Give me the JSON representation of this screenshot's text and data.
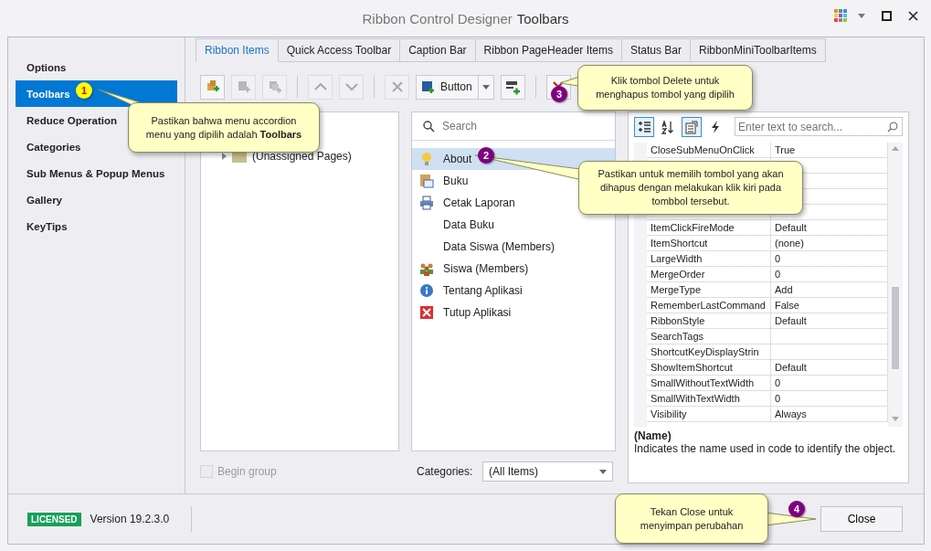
{
  "window": {
    "title": "Ribbon Control Designer",
    "subtitle": "Toolbars"
  },
  "sidebar": {
    "items": [
      {
        "label": "Options",
        "selected": false
      },
      {
        "label": "Toolbars",
        "selected": true
      },
      {
        "label": "Reduce Operation",
        "selected": false
      },
      {
        "label": "Categories",
        "selected": false
      },
      {
        "label": "Sub Menus & Popup Menus",
        "selected": false
      },
      {
        "label": "Gallery",
        "selected": false
      },
      {
        "label": "KeyTips",
        "selected": false
      }
    ]
  },
  "tabs": [
    {
      "label": "Ribbon Items",
      "selected": true
    },
    {
      "label": "Quick Access Toolbar",
      "selected": false
    },
    {
      "label": "Caption Bar",
      "selected": false
    },
    {
      "label": "Ribbon PageHeader Items",
      "selected": false
    },
    {
      "label": "Status Bar",
      "selected": false
    },
    {
      "label": "RibbonMiniToolbarItems",
      "selected": false
    }
  ],
  "toolbar": [
    {
      "kind": "add-link",
      "disabled": false
    },
    {
      "kind": "remove-link",
      "disabled": true
    },
    {
      "kind": "copy-link",
      "disabled": true
    },
    {
      "kind": "separator"
    },
    {
      "kind": "move-up",
      "disabled": true
    },
    {
      "kind": "move-down",
      "disabled": true
    },
    {
      "kind": "separator"
    },
    {
      "kind": "cancel",
      "disabled": true
    },
    {
      "kind": "item-type",
      "label": "Button"
    },
    {
      "kind": "add-item",
      "disabled": false
    },
    {
      "kind": "separator"
    },
    {
      "kind": "delete",
      "disabled": false
    }
  ],
  "tree": {
    "items": [
      {
        "label": "(Unassigned Pages)",
        "expanded": false
      }
    ]
  },
  "item_list": {
    "search_placeholder": "Search",
    "items": [
      {
        "label": "About",
        "kind": "bulb",
        "selected": true
      },
      {
        "label": "Buku",
        "kind": "calendar",
        "selected": false
      },
      {
        "label": "Cetak Laporan",
        "kind": "printer",
        "selected": false
      },
      {
        "label": "Data Buku",
        "kind": "none",
        "selected": false
      },
      {
        "label": "Data Siswa (Members)",
        "kind": "none",
        "selected": false
      },
      {
        "label": "Siswa (Members)",
        "kind": "people",
        "selected": false
      },
      {
        "label": "Tentang Aplikasi",
        "kind": "info",
        "selected": false
      },
      {
        "label": "Tutup Aplikasi",
        "kind": "close",
        "selected": false
      }
    ]
  },
  "properties": {
    "tools": [
      {
        "kind": "categorized",
        "selected": true
      },
      {
        "kind": "alphabetical",
        "selected": false
      },
      {
        "kind": "pages",
        "selected": true
      },
      {
        "kind": "events",
        "selected": false
      }
    ],
    "search_placeholder": "Enter text to search...",
    "rows": [
      {
        "name": "CloseSubMenuOnClick",
        "value": "True"
      },
      {
        "name": "ItemClickFireMode",
        "value": "Default"
      },
      {
        "name": "ItemShortcut",
        "value": "(none)"
      },
      {
        "name": "LargeWidth",
        "value": "0"
      },
      {
        "name": "MergeOrder",
        "value": "0"
      },
      {
        "name": "MergeType",
        "value": "Add"
      },
      {
        "name": "RememberLastCommand",
        "value": "False"
      },
      {
        "name": "RibbonStyle",
        "value": "Default"
      },
      {
        "name": "SearchTags"
      },
      {
        "name": "ShortcutKeyDisplayStrin"
      },
      {
        "name": "ShowItemShortcut",
        "value": "Default"
      },
      {
        "name": "SmallWithoutTextWidth",
        "value": "0"
      },
      {
        "name": "SmallWithTextWidth",
        "value": "0"
      },
      {
        "name": "Visibility",
        "value": "Always"
      }
    ],
    "description_title": "(Name)",
    "description": "Indicates the name used in code to identify the object."
  },
  "begin_group": {
    "label": "Begin group",
    "checked": false,
    "disabled": true
  },
  "categories": {
    "label": "Categories:",
    "value": "(All Items)"
  },
  "footer": {
    "badge": "LICENSED",
    "version": "Version 19.2.3.0",
    "close_button": "Close"
  },
  "callouts": [
    {
      "number": "1",
      "color": "#ffff00",
      "text": "Pastikan bahwa menu accordion menu yang dipilih adalah **Toolbars**"
    },
    {
      "number": "3",
      "color": "#800080",
      "text": "Klik tombol Delete untuk menghapus tombol yang dipilih"
    },
    {
      "number": "2",
      "color": "#800080",
      "text": "Pastikan untuk memilih tombol yang akan dihapus dengan melakukan klik kiri pada tombbol tersebut."
    },
    {
      "number": "4",
      "color": "#800080",
      "text": "Tekan Close untuk menyimpan perubahan"
    }
  ]
}
